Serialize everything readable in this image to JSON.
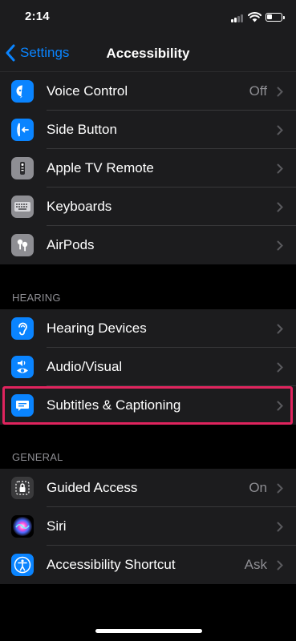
{
  "status_bar": {
    "time": "2:14",
    "battery_level": 0.35
  },
  "nav": {
    "back_label": "Settings",
    "title": "Accessibility"
  },
  "sections": [
    {
      "header": "",
      "rows": [
        {
          "label": "Voice Control",
          "value": "Off",
          "icon": "voice-control-icon",
          "color": "#0a84ff"
        },
        {
          "label": "Side Button",
          "value": "",
          "icon": "side-button-icon",
          "color": "#0a84ff"
        },
        {
          "label": "Apple TV Remote",
          "value": "",
          "icon": "apple-tv-remote-icon",
          "color": "#8e8e93"
        },
        {
          "label": "Keyboards",
          "value": "",
          "icon": "keyboard-icon",
          "color": "#8e8e93"
        },
        {
          "label": "AirPods",
          "value": "",
          "icon": "airpods-icon",
          "color": "#8e8e93"
        }
      ]
    },
    {
      "header": "HEARING",
      "rows": [
        {
          "label": "Hearing Devices",
          "value": "",
          "icon": "ear-icon",
          "color": "#0a84ff"
        },
        {
          "label": "Audio/Visual",
          "value": "",
          "icon": "audio-visual-icon",
          "color": "#0a84ff"
        },
        {
          "label": "Subtitles & Captioning",
          "value": "",
          "icon": "subtitles-icon",
          "color": "#0a84ff"
        }
      ]
    },
    {
      "header": "GENERAL",
      "rows": [
        {
          "label": "Guided Access",
          "value": "On",
          "icon": "lock-icon",
          "color": "#3a3a3c"
        },
        {
          "label": "Siri",
          "value": "",
          "icon": "siri-icon",
          "color": "#000000"
        },
        {
          "label": "Accessibility Shortcut",
          "value": "Ask",
          "icon": "accessibility-icon",
          "color": "#0a84ff"
        }
      ]
    }
  ],
  "highlighted_row": "Subtitles & Captioning",
  "colors": {
    "accent": "#0a84ff",
    "highlight": "#e0245e",
    "background": "#000000",
    "cell": "#1c1c1e"
  }
}
